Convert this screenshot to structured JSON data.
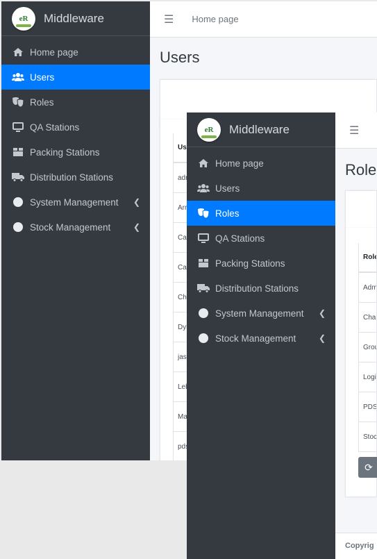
{
  "brand": {
    "name": "Middleware"
  },
  "sidebar": {
    "items": [
      {
        "label": "Home page",
        "icon": "home-icon"
      },
      {
        "label": "Users",
        "icon": "users-icon"
      },
      {
        "label": "Roles",
        "icon": "masks-icon"
      },
      {
        "label": "QA Stations",
        "icon": "monitor-icon"
      },
      {
        "label": "Packing Stations",
        "icon": "box-icon"
      },
      {
        "label": "Distribution Stations",
        "icon": "truck-icon"
      },
      {
        "label": "System Management",
        "icon": "circle-icon"
      },
      {
        "label": "Stock Management",
        "icon": "circle-icon"
      }
    ]
  },
  "window1": {
    "active_item": "Users",
    "breadcrumb": "Home page",
    "page_title": "Users",
    "table": {
      "header": "Us",
      "rows": [
        "adr",
        "Arr",
        "Cal",
        "Car",
        "Cha",
        "Dyl",
        "jas",
        "Leb",
        "Ma",
        "pds"
      ]
    }
  },
  "window2": {
    "active_item": "Roles",
    "page_title": "Role",
    "table": {
      "header": "Role",
      "rows": [
        "Adm",
        "Char",
        "Grou",
        "Logi",
        "PDS",
        "Stoc"
      ]
    },
    "footer": "Copyrig"
  },
  "colors": {
    "sidebar_bg": "#343a40",
    "active_bg": "#007bff",
    "content_bg": "#f4f6f9"
  }
}
